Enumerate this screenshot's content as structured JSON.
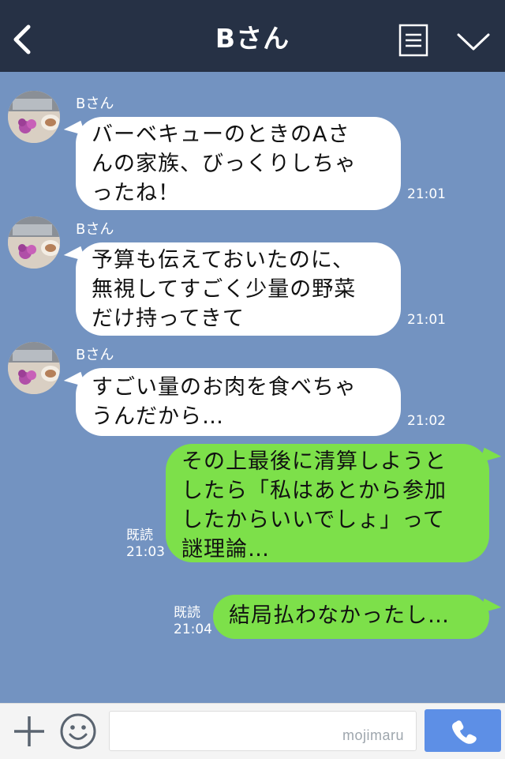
{
  "header": {
    "title": "Bさん",
    "back_icon": "chevron-left-icon",
    "menu_icon": "note-list-icon",
    "expand_icon": "chevron-down-icon",
    "bg_color": "#263145"
  },
  "chat": {
    "bg_color": "#7393c1",
    "messages": [
      {
        "from": "Bさん",
        "direction": "incoming",
        "text": "バーベキューのときのAさ\nんの家族、びっくりしちゃ\nったね！",
        "time": "21:01"
      },
      {
        "from": "Bさん",
        "direction": "incoming",
        "text": "予算も伝えておいたのに、\n無視してすごく少量の野菜\nだけ持ってきて",
        "time": "21:01"
      },
      {
        "from": "Bさん",
        "direction": "incoming",
        "text": "すごい量のお肉を食べちゃ\nうんだから…",
        "time": "21:02"
      },
      {
        "direction": "outgoing",
        "text": "その上最後に清算しようと\nしたら「私はあとから参加\nしたからいいでしょ」って\n謎理論…",
        "read": "既読",
        "time": "21:03"
      },
      {
        "direction": "outgoing",
        "text": "結局払わなかったし…",
        "read": "既読",
        "time": "21:04"
      }
    ]
  },
  "footer": {
    "plus_icon": "plus-icon",
    "emoji_icon": "smiley-icon",
    "input_value": "",
    "watermark": "mojimaru",
    "call_icon": "phone-icon",
    "call_color": "#5d8fe6"
  },
  "colors": {
    "incoming_bubble": "#ffffff",
    "outgoing_bubble": "#7de04a"
  }
}
